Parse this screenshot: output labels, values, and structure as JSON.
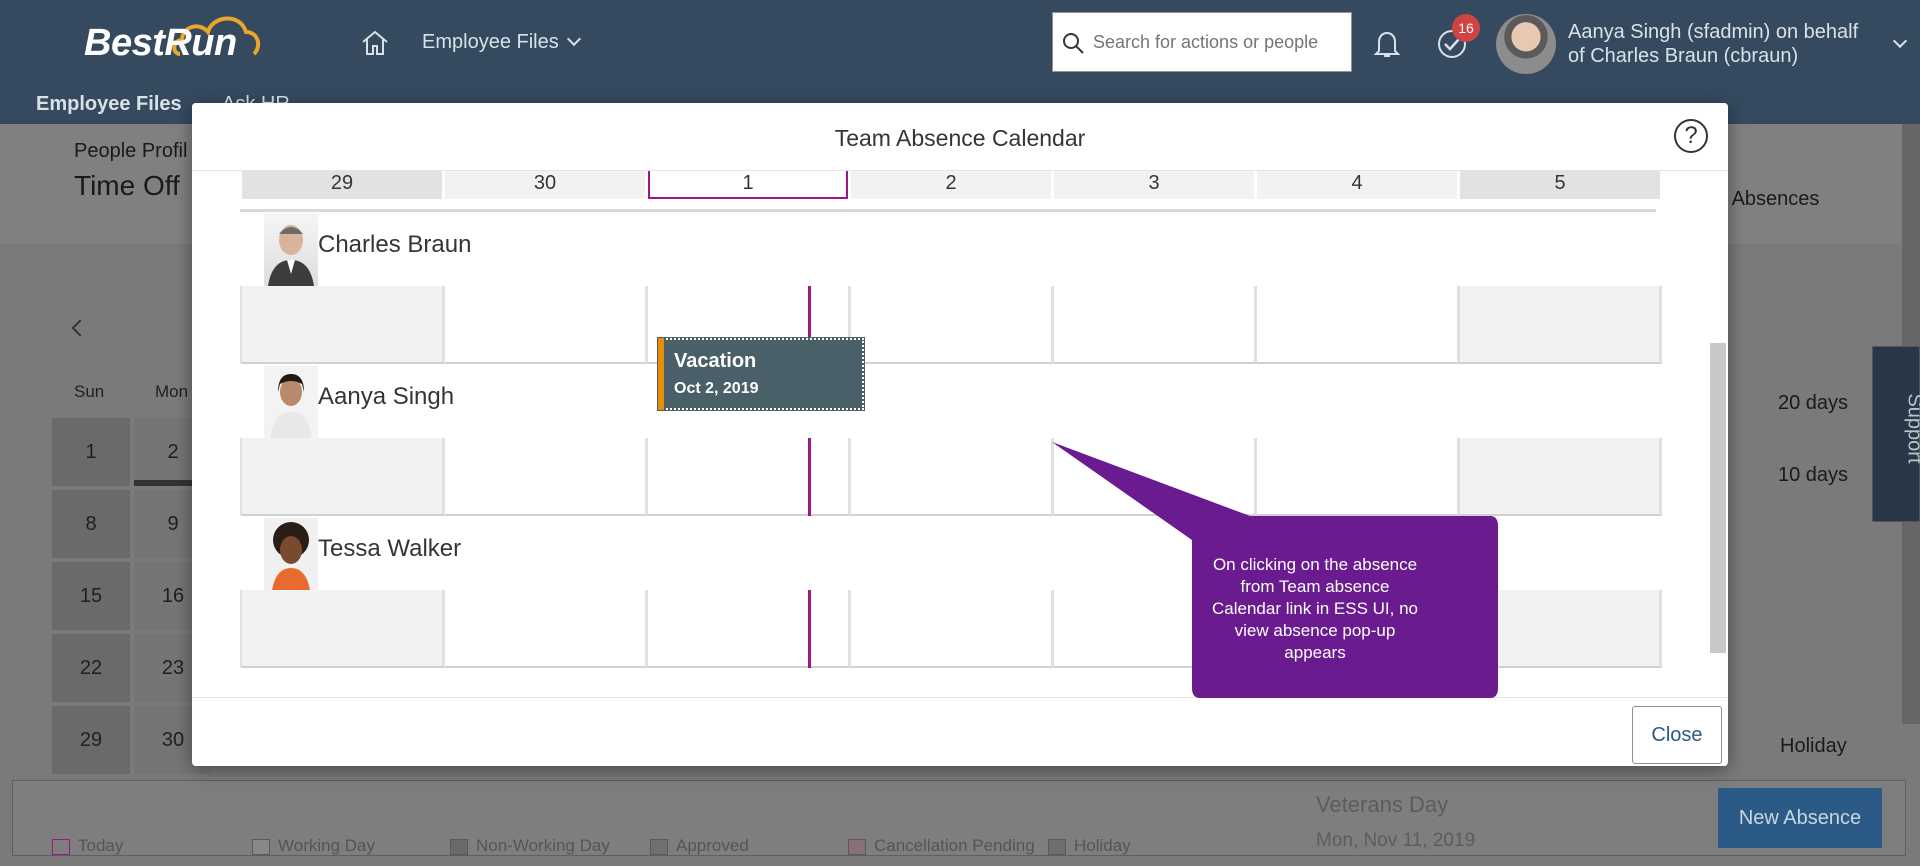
{
  "shell": {
    "logo": "BestRun",
    "nav_label": "Employee Files",
    "search_placeholder": "Search for actions or people",
    "todo_count": "16",
    "user_line": "Aanya Singh (sfadmin) on behalf of Charles Braun (cbraun)",
    "subnav_active": "Employee Files",
    "subnav_other": "Ask HR"
  },
  "background": {
    "people_profile": "People Profil",
    "page_title": "Time Off",
    "absences_label": "n Absences",
    "weekdays": [
      "Sun",
      "Mon"
    ],
    "days_sun": [
      "1",
      "8",
      "15",
      "22",
      "29"
    ],
    "days_mon": [
      "2",
      "9",
      "16",
      "23",
      "30"
    ],
    "balance_1": "20 days",
    "balance_2": "10 days",
    "holiday": "Holiday",
    "holiday_title": "Veterans Day",
    "holiday_date": "Mon, Nov 11, 2019",
    "support": "Support",
    "new_absence": "New Absence",
    "legend": [
      "Today",
      "Working Day",
      "Non-Working Day",
      "Approved",
      "Cancellation Pending",
      "Holiday"
    ]
  },
  "dialog": {
    "title": "Team Absence Calendar",
    "help": "?",
    "close": "Close",
    "days": [
      "29",
      "30",
      "1",
      "2",
      "3",
      "4",
      "5"
    ],
    "employees": [
      {
        "name": "Charles Braun"
      },
      {
        "name": "Aanya Singh"
      },
      {
        "name": "Tessa Walker"
      }
    ],
    "absence": {
      "type": "Vacation",
      "date": "Oct 2, 2019"
    }
  },
  "callout": {
    "text": "On clicking on the absence from Team absence Calendar link in ESS UI, no view absence pop-up appears",
    "color": "#6a1b8f"
  },
  "colors": {
    "shell": "#354a5f",
    "today": "#a0148c",
    "vacation": "#4a6068",
    "vacation_accent": "#e78c07"
  }
}
